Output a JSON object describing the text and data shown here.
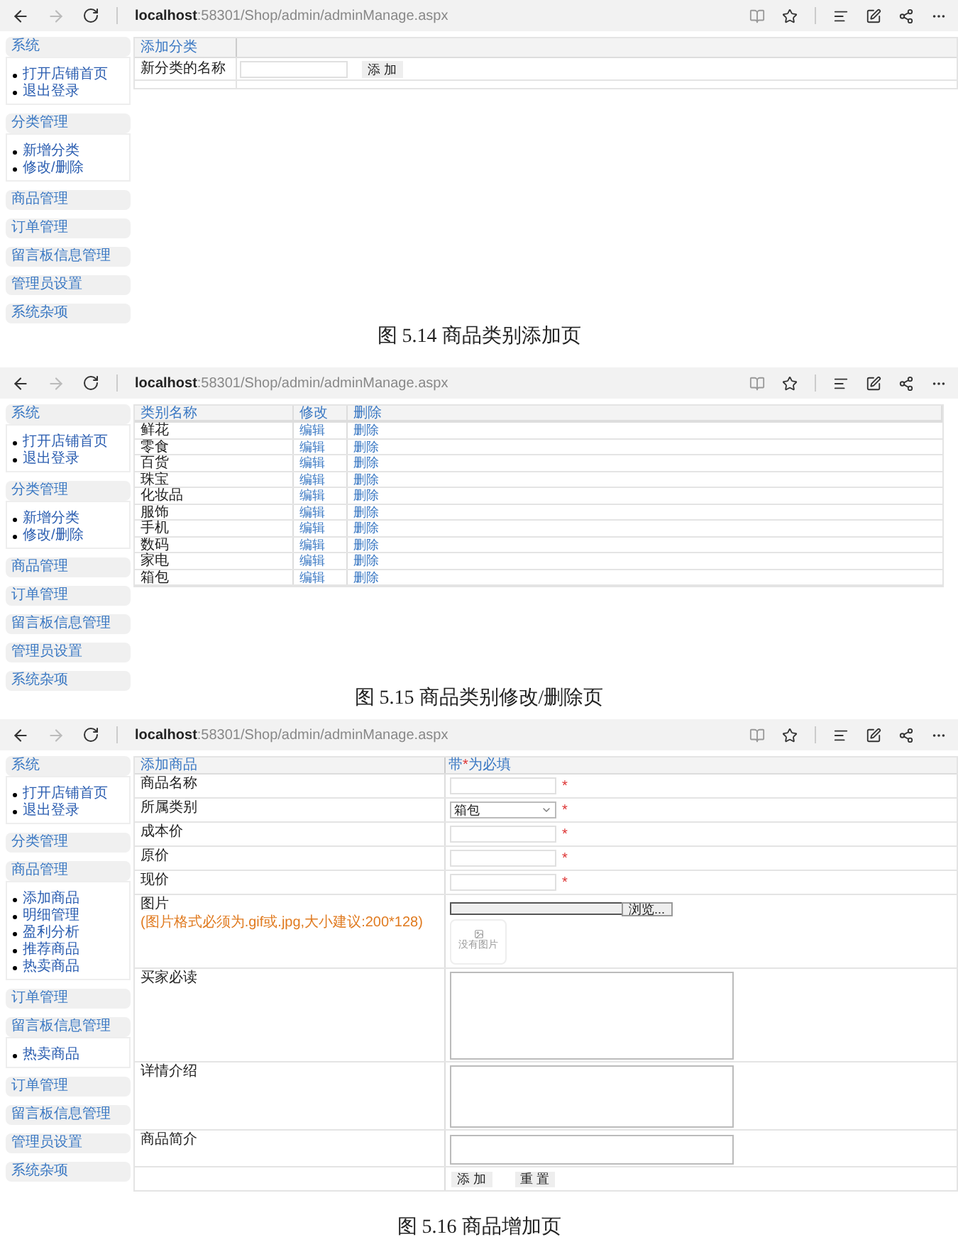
{
  "figures": [
    {
      "kind": "category_add",
      "browser": {
        "url_host": "localhost",
        "url_path": ":58301/Shop/admin/adminManage.aspx",
        "forward_disabled": true
      },
      "sidebar": [
        {
          "title": "系统",
          "items": [
            "打开店铺首页",
            "退出登录"
          ]
        },
        {
          "title": "分类管理",
          "items": [
            "新增分类",
            "修改/删除"
          ]
        },
        {
          "title": "商品管理"
        },
        {
          "title": "订单管理"
        },
        {
          "title": "留言板信息管理"
        },
        {
          "title": "管理员设置"
        },
        {
          "title": "系统杂项"
        }
      ],
      "form": {
        "title": "添加分类",
        "label": "新分类的名称",
        "button": "添 加"
      },
      "caption": "图 5.14 商品类别添加页"
    },
    {
      "kind": "category_list",
      "browser": {
        "url_host": "localhost",
        "url_path": ":58301/Shop/admin/adminManage.aspx",
        "forward_disabled": true
      },
      "sidebar": [
        {
          "title": "系统",
          "items": [
            "打开店铺首页",
            "退出登录"
          ]
        },
        {
          "title": "分类管理",
          "items": [
            "新增分类",
            "修改/删除"
          ]
        },
        {
          "title": "商品管理"
        },
        {
          "title": "订单管理"
        },
        {
          "title": "留言板信息管理"
        },
        {
          "title": "管理员设置"
        },
        {
          "title": "系统杂项"
        }
      ],
      "table": {
        "columns": [
          "类别名称",
          "修改",
          "删除"
        ],
        "rows": [
          {
            "name": "鲜花",
            "edit": "编辑",
            "delete": "删除"
          },
          {
            "name": "零食",
            "edit": "编辑",
            "delete": "删除"
          },
          {
            "name": "百货",
            "edit": "编辑",
            "delete": "删除"
          },
          {
            "name": "珠宝",
            "edit": "编辑",
            "delete": "删除"
          },
          {
            "name": "化妆品",
            "edit": "编辑",
            "delete": "删除"
          },
          {
            "name": "服饰",
            "edit": "编辑",
            "delete": "删除"
          },
          {
            "name": "手机",
            "edit": "编辑",
            "delete": "删除"
          },
          {
            "name": "数码",
            "edit": "编辑",
            "delete": "删除"
          },
          {
            "name": "家电",
            "edit": "编辑",
            "delete": "删除"
          },
          {
            "name": "箱包",
            "edit": "编辑",
            "delete": "删除"
          }
        ]
      },
      "caption": "图 5.15 商品类别修改/删除页"
    },
    {
      "kind": "product_add",
      "browser": {
        "url_host": "localhost",
        "url_path": ":58301/Shop/admin/adminManage.aspx",
        "forward_disabled": true
      },
      "sidebar": [
        {
          "title": "系统",
          "items": [
            "打开店铺首页",
            "退出登录"
          ]
        },
        {
          "title": "分类管理"
        },
        {
          "title": "商品管理",
          "items": [
            "添加商品",
            "明细管理",
            "盈利分析",
            "推荐商品",
            "热卖商品"
          ]
        },
        {
          "title": "订单管理"
        },
        {
          "title": "留言板信息管理",
          "items": [
            "热卖商品"
          ]
        },
        {
          "title": "订单管理"
        },
        {
          "title": "留言板信息管理"
        },
        {
          "title": "管理员设置"
        },
        {
          "title": "系统杂项"
        }
      ],
      "product_form": {
        "title": "添加商品",
        "note": [
          "带",
          "*",
          "为必填"
        ],
        "fields": [
          {
            "kind": "text",
            "label": "商品名称",
            "required": true
          },
          {
            "kind": "select",
            "label": "所属类别",
            "value": "箱包",
            "required": true
          },
          {
            "kind": "text",
            "label": "成本价",
            "required": true
          },
          {
            "kind": "text",
            "label": "原价",
            "required": true
          },
          {
            "kind": "text",
            "label": "现价",
            "required": true
          },
          {
            "kind": "image",
            "label": "图片",
            "hint": "(图片格式必须为.gif或.jpg,大小建议:200*128)",
            "browse": "浏览...",
            "no_image": "没有图片",
            "required": false
          },
          {
            "kind": "textarea",
            "label": "买家必读",
            "required": false
          },
          {
            "kind": "textarea",
            "label": "详情介绍",
            "required": false
          },
          {
            "kind": "textarea",
            "label": "商品简介",
            "required": false
          }
        ],
        "buttons": [
          "添 加",
          "重 置"
        ]
      },
      "caption": "图 5.16 商品增加页"
    }
  ]
}
